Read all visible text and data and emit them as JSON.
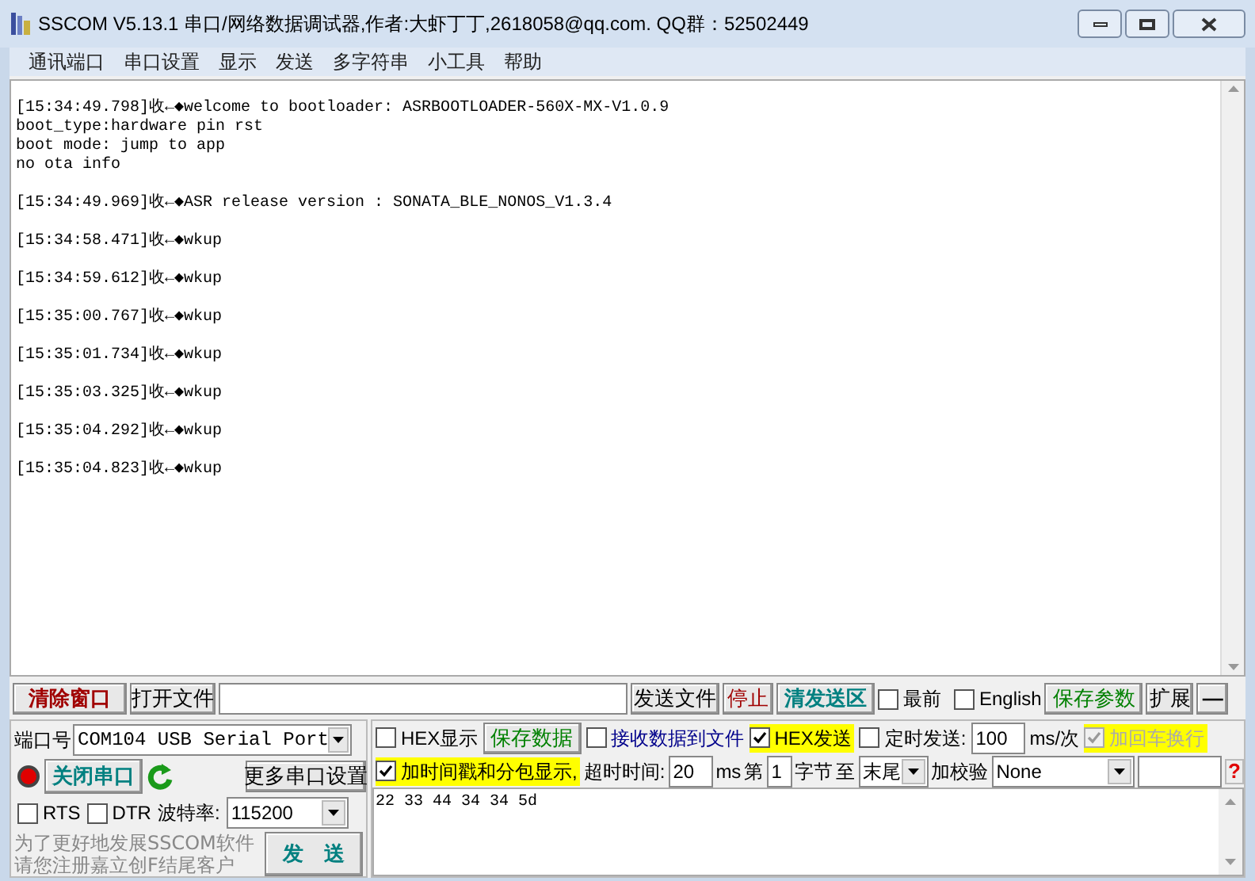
{
  "window": {
    "title": "SSCOM V5.13.1 串口/网络数据调试器,作者:大虾丁丁,2618058@qq.com. QQ群：52502449"
  },
  "menu": [
    "通讯端口",
    "串口设置",
    "显示",
    "发送",
    "多字符串",
    "小工具",
    "帮助"
  ],
  "log": [
    {
      "lines": [
        "[15:34:49.798]收←◆welcome to bootloader: ASRBOOTLOADER-560X-MX-V1.0.9",
        "boot_type:hardware pin rst",
        "boot mode: jump to app",
        "no ota info"
      ]
    },
    {
      "lines": [
        "[15:34:49.969]收←◆ASR release version : SONATA_BLE_NONOS_V1.3.4"
      ]
    },
    {
      "lines": [
        "[15:34:58.471]收←◆wkup"
      ]
    },
    {
      "lines": [
        "[15:34:59.612]收←◆wkup"
      ]
    },
    {
      "lines": [
        "[15:35:00.767]收←◆wkup"
      ]
    },
    {
      "lines": [
        "[15:35:01.734]收←◆wkup"
      ]
    },
    {
      "lines": [
        "[15:35:03.325]收←◆wkup"
      ]
    },
    {
      "lines": [
        "[15:35:04.292]收←◆wkup"
      ]
    },
    {
      "lines": [
        "[15:35:04.823]收←◆wkup"
      ]
    }
  ],
  "toolbar": {
    "clear_button": "清除窗口",
    "open_file_button": "打开文件",
    "send_file_button": "发送文件",
    "stop_button": "停止",
    "clear_send_button": "清发送区",
    "topmost": {
      "label": "最前",
      "checked": false
    },
    "english": {
      "label": "English",
      "checked": false
    },
    "save_params_button": "保存参数",
    "expand_button": "扩展",
    "collapse_button": "—"
  },
  "port": {
    "label": "端口号",
    "value": "COM104 USB Serial Port",
    "open": true,
    "close_button": "关闭串口",
    "more_button": "更多串口设置",
    "rts": {
      "label": "RTS",
      "checked": false
    },
    "dtr": {
      "label": "DTR",
      "checked": false
    },
    "baud_label": "波特率:",
    "baud": "115200"
  },
  "promo": [
    "为了更好地发展SSCOM软件",
    "请您注册嘉立创F结尾客户"
  ],
  "send_button": "发　送",
  "options": {
    "hex_display": {
      "label": "HEX显示",
      "checked": false
    },
    "save_data_button": "保存数据",
    "recv_to_file": {
      "label": "接收数据到文件",
      "checked": false
    },
    "hex_send": {
      "label": "HEX发送",
      "checked": true
    },
    "timed_send": {
      "label": "定时发送:",
      "checked": false
    },
    "interval": "100",
    "interval_unit": "ms/次",
    "add_crlf": {
      "label": "加回车换行",
      "checked": true,
      "disabled": true
    },
    "timestamp": {
      "label": "加时间戳和分包显示,",
      "checked": true
    },
    "timeout_label": "超时时间:",
    "timeout": "20",
    "timeout_unit": "ms",
    "from_label": "第",
    "from": "1",
    "byte_label": "字节",
    "to_label": "至",
    "to": "末尾",
    "checksum_label": "加校验",
    "checksum": "None",
    "help": "?"
  },
  "send_text": "22 33 44 34 34 5d"
}
